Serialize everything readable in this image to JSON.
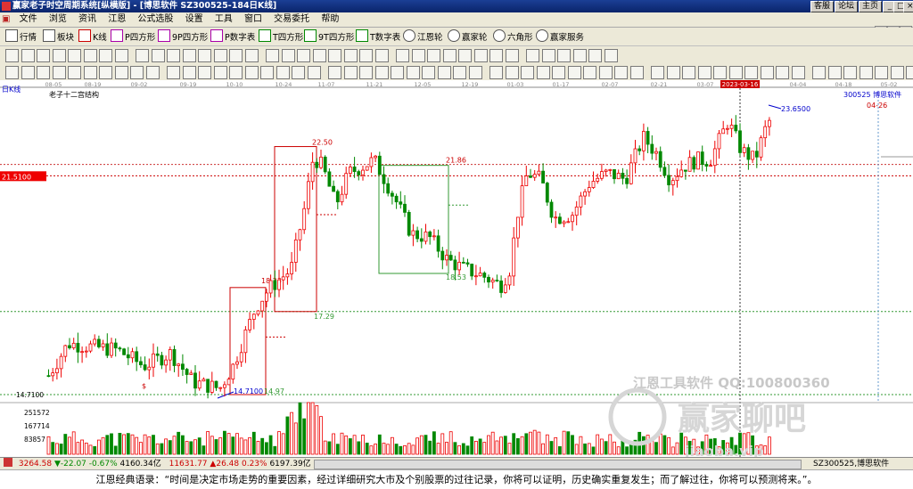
{
  "window": {
    "title": "赢家老子时空周期系统[纵横版] - [博思软件  SZ300525-184日K线]",
    "top_buttons": [
      "客服",
      "论坛",
      "主页"
    ]
  },
  "menu": [
    "文件",
    "浏览",
    "资讯",
    "江恩",
    "公式选股",
    "设置",
    "工具",
    "窗口",
    "交易委托",
    "帮助"
  ],
  "toolbar": {
    "items": [
      {
        "label": "行情",
        "icon": "quote-icon"
      },
      {
        "label": "板块",
        "icon": "sector-icon"
      },
      {
        "label": "K线",
        "icon": "kline-icon"
      },
      {
        "label": "P四方形",
        "icon": "square-icon"
      },
      {
        "label": "9P四方形",
        "icon": "square-icon"
      },
      {
        "label": "P数字表",
        "icon": "table-icon"
      },
      {
        "label": "T四方形",
        "icon": "square-icon"
      },
      {
        "label": "9T四方形",
        "icon": "square-icon"
      },
      {
        "label": "T数字表",
        "icon": "table-icon"
      },
      {
        "label": "江恩轮",
        "icon": "wheel-icon"
      },
      {
        "label": "赢家轮",
        "icon": "wheel-icon"
      },
      {
        "label": "六角形",
        "icon": "hexagon-icon"
      },
      {
        "label": "赢家服务",
        "icon": "service-icon"
      }
    ]
  },
  "chart": {
    "period_label": "日K线",
    "structure_label": "老子十二宫结构",
    "stock_label": "300525 博思软件",
    "date_marker": "2023-03-16",
    "side_price_label": "21.5100",
    "low_axis_label": "14.7100",
    "volume_labels": [
      "251572",
      "167714",
      "83857"
    ],
    "date_ticks": [
      "08-05",
      "08-19",
      "09-02",
      "09-19",
      "10-10",
      "10-24",
      "11-07",
      "11-21",
      "12-05",
      "12-19",
      "01-03",
      "01-17",
      "02-07",
      "02-21",
      "03-07",
      "04-04",
      "04-18",
      "05-02"
    ],
    "annotations": {
      "high1": "22.50",
      "pivot1": "18.23",
      "low1": "17.29",
      "line_2186": "21.86",
      "low2": "18.53",
      "last_high": "23.6500",
      "future_date": "04-26",
      "bottom_low": "14.7100",
      "bottom_next": "14.97"
    },
    "watermark": {
      "line1": "江恩工具软件  QQ:100800360",
      "line2": "赢家聊吧",
      "line3": "jiaoba.vip"
    },
    "chart_data": {
      "type": "candlestick",
      "price_range": [
        14.71,
        23.65
      ],
      "current_price": 21.51
    }
  },
  "status": {
    "sh_index": "3264.58",
    "sh_change": "▼-22.07",
    "sh_pct": "-0.67%",
    "sh_amount": "4160.34亿",
    "sz_index": "11631.77",
    "sz_change": "▲26.48",
    "sz_pct": "0.23%",
    "sz_amount": "6197.39亿",
    "right_label": "SZ300525,博思软件"
  },
  "quote": "江恩经典语录：“时间是决定市场走势的重要因素，经过详细研究大市及个别股票的过往记录，你将可以证明，历史确实重复发生；而了解过往，你将可以预测将来。”。"
}
